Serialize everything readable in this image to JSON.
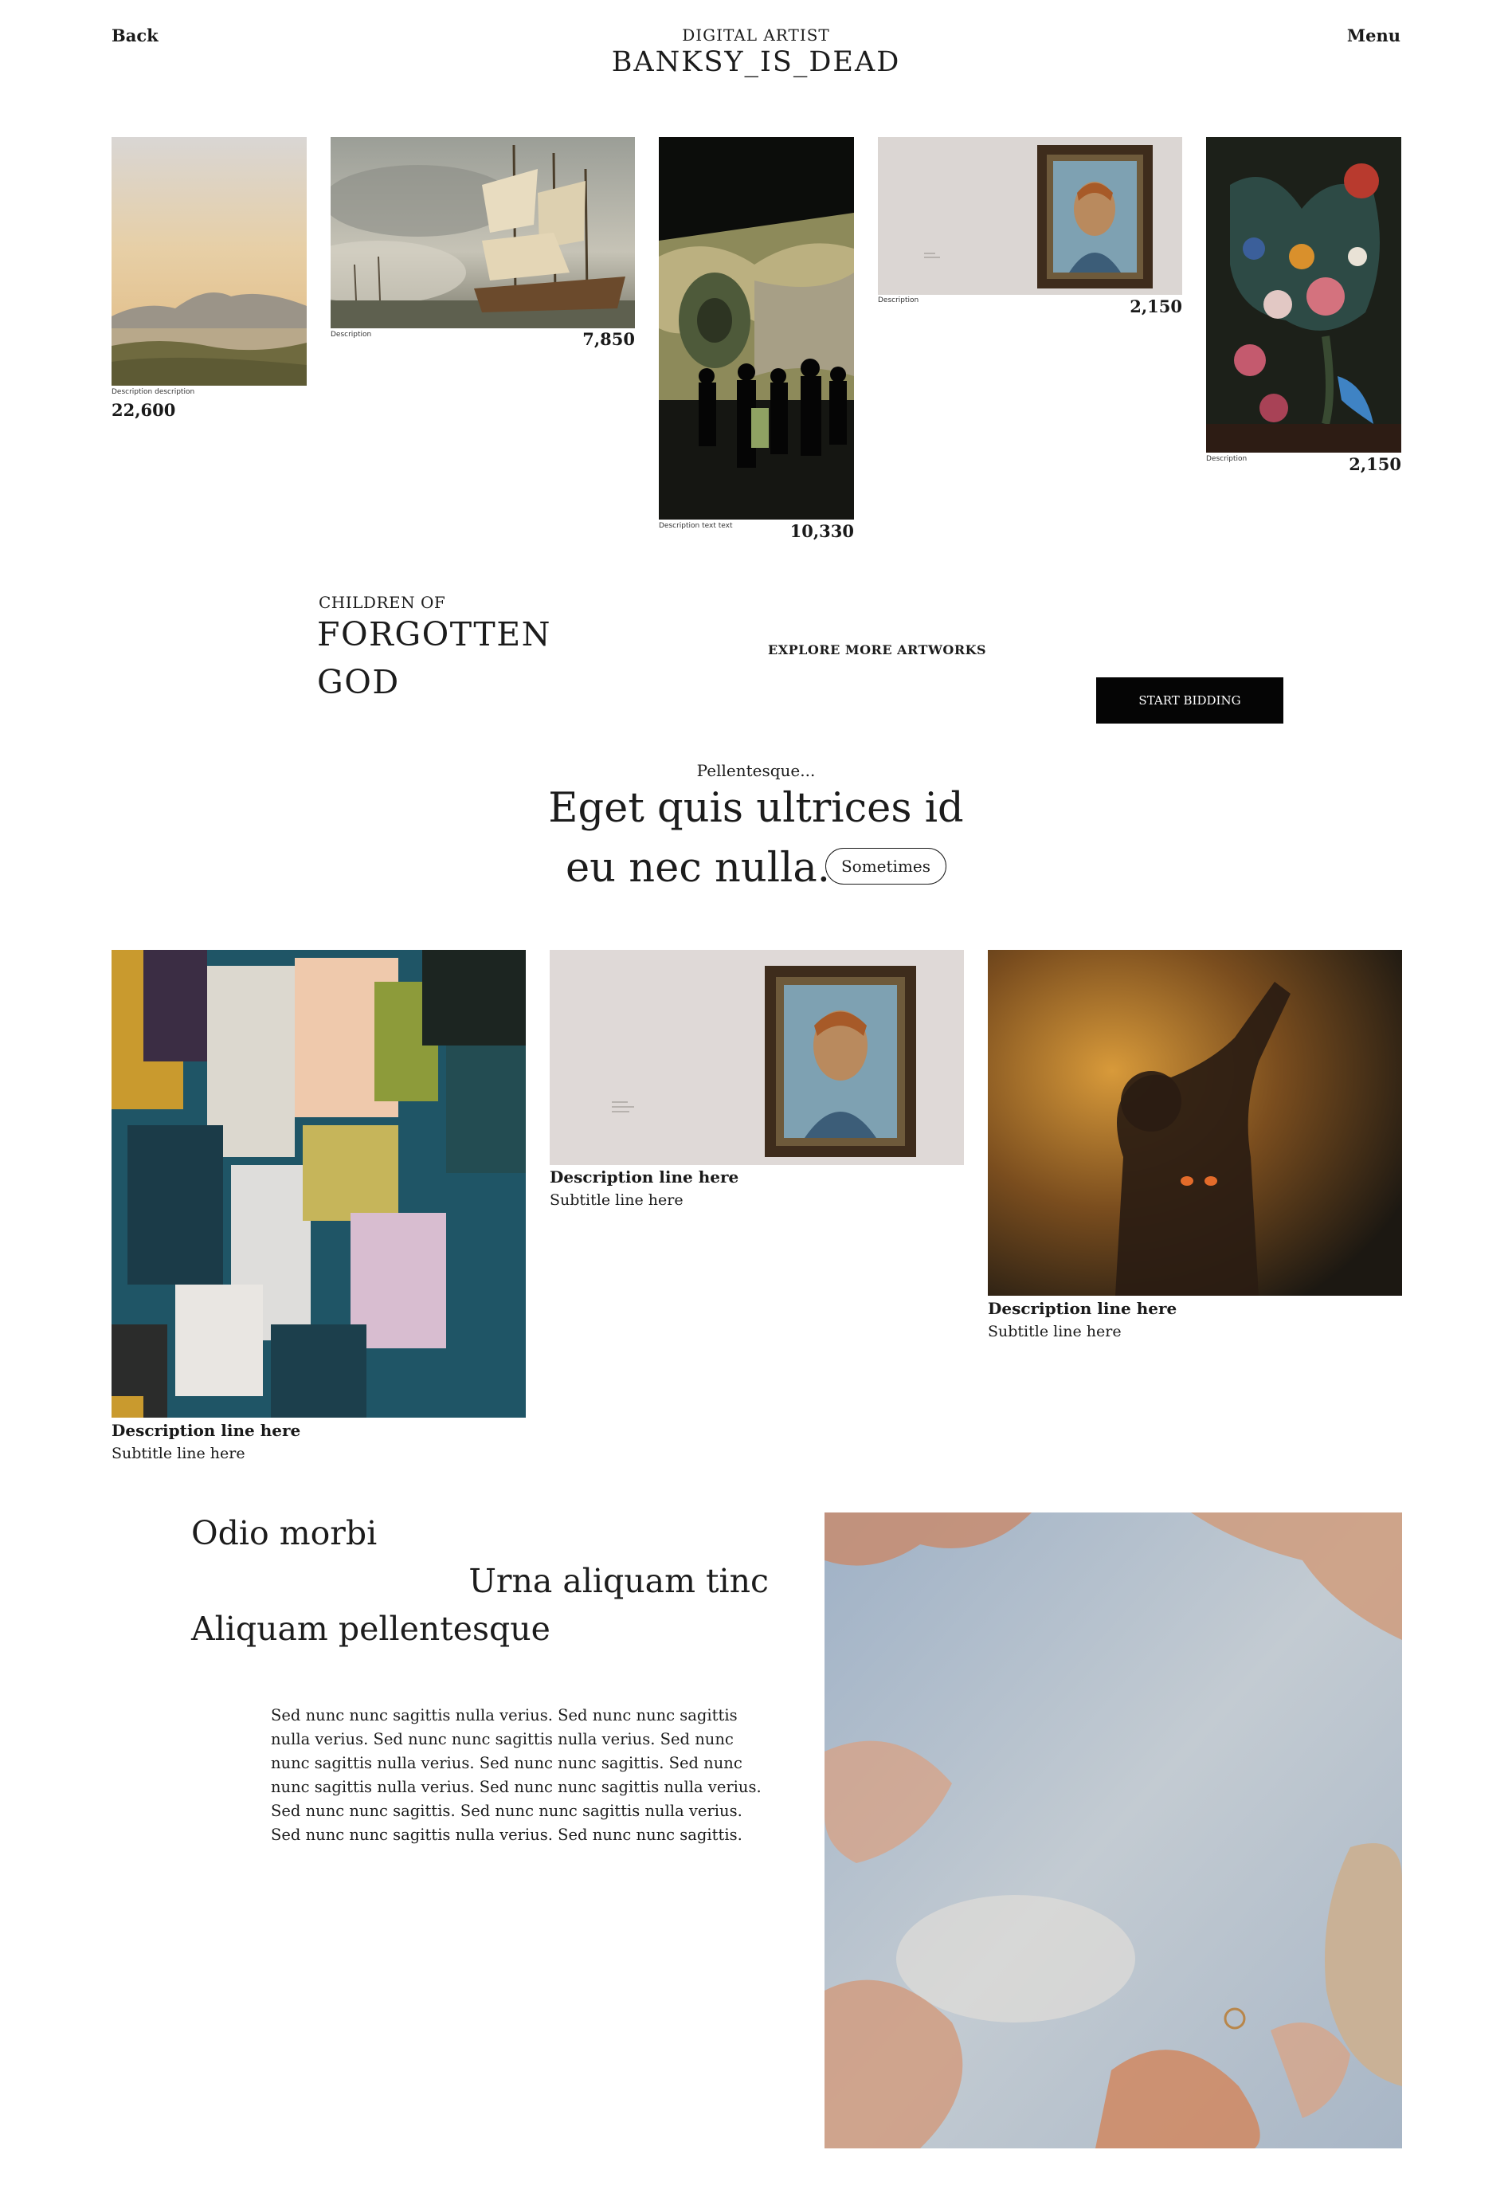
{
  "header": {
    "back_label": "Back",
    "artist_kicker": "DIGITAL ARTIST",
    "artist_name": "BANKSY_IS_DEAD",
    "menu_label": "Menu"
  },
  "gallery": [
    {
      "desc": "Description description",
      "price": "22,600"
    },
    {
      "desc": "Description",
      "price": "7,850"
    },
    {
      "desc": "Description text text",
      "price": "10,330"
    },
    {
      "desc": "Description",
      "price": "2,150"
    },
    {
      "desc": "Description",
      "price": "2,150"
    }
  ],
  "feature": {
    "kicker": "CHILDREN OF",
    "title_line1": "FORGOTTEN",
    "title_line2": "GOD",
    "explore_label": "EXPLORE MORE ARTWORKS",
    "bid_label": "START BIDDING"
  },
  "headline": {
    "kicker": "Pellentesque...",
    "line1": "Eget quis ultrices id",
    "line2": "eu nec nulla.",
    "pill_label": "Sometimes"
  },
  "cards": [
    {
      "title": "Description line here",
      "subtitle": "Subtitle line here"
    },
    {
      "title": "Description line here",
      "subtitle": "Subtitle line here"
    },
    {
      "title": "Description line here",
      "subtitle": "Subtitle line here"
    }
  ],
  "story": {
    "line1": "Odio morbi",
    "line2": "Urna aliquam tinc",
    "line3": "Aliquam pellentesque",
    "paragraph": "Sed nunc nunc sagittis nulla verius. Sed nunc nunc sagittis nulla verius. Sed nunc nunc sagittis nulla verius. Sed nunc nunc sagittis nulla verius. Sed nunc nunc sagittis. Sed nunc nunc sagittis nulla verius. Sed nunc nunc sagittis nulla verius. Sed nunc nunc sagittis. Sed nunc nunc sagittis nulla verius. Sed nunc nunc sagittis nulla verius. Sed nunc nunc sagittis."
  }
}
